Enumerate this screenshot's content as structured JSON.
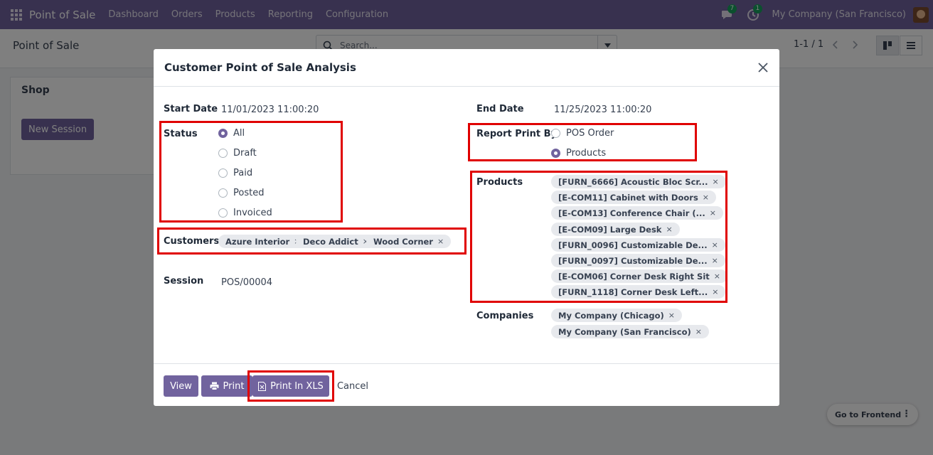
{
  "navbar": {
    "app_name": "Point of Sale",
    "menu": [
      "Dashboard",
      "Orders",
      "Products",
      "Reporting",
      "Configuration"
    ],
    "messages_badge": "7",
    "activities_badge": "1",
    "company": "My Company (San Francisco)"
  },
  "control_panel": {
    "breadcrumb": "Point of Sale",
    "search_placeholder": "Search...",
    "pager": "1-1 / 1"
  },
  "background": {
    "shop_title": "Shop",
    "new_session_label": "New Session",
    "go_to_frontend_label": "Go to Frontend"
  },
  "modal": {
    "title": "Customer Point of Sale Analysis",
    "start_date_label": "Start Date",
    "start_date_value": "11/01/2023 11:00:20",
    "end_date_label": "End Date",
    "end_date_value": "11/25/2023 11:00:20",
    "status_label": "Status",
    "status_options": [
      "All",
      "Draft",
      "Paid",
      "Posted",
      "Invoiced"
    ],
    "status_selected": "All",
    "report_print_by_label": "Report Print By",
    "report_print_by_options": [
      "POS Order",
      "Products"
    ],
    "report_print_by_selected": "Products",
    "customers_label": "Customers",
    "customers": [
      "Azure Interior",
      "Deco Addict",
      "Wood Corner"
    ],
    "session_label": "Session",
    "session_value": "POS/00004",
    "products_label": "Products",
    "products": [
      "[FURN_6666] Acoustic Bloc Scr...",
      "[E-COM11] Cabinet with Doors",
      "[E-COM13] Conference Chair (...",
      "[E-COM09] Large Desk",
      "[FURN_0096] Customizable De...",
      "[FURN_0097] Customizable De...",
      "[E-COM06] Corner Desk Right Sit",
      "[FURN_1118] Corner Desk Left..."
    ],
    "companies_label": "Companies",
    "companies": [
      "My Company (Chicago)",
      "My Company (San Francisco)"
    ],
    "buttons": {
      "view": "View",
      "print": "Print",
      "print_xls": "Print In XLS",
      "cancel": "Cancel"
    }
  },
  "colors": {
    "brand": "#71639e",
    "highlight": "#e00000"
  }
}
